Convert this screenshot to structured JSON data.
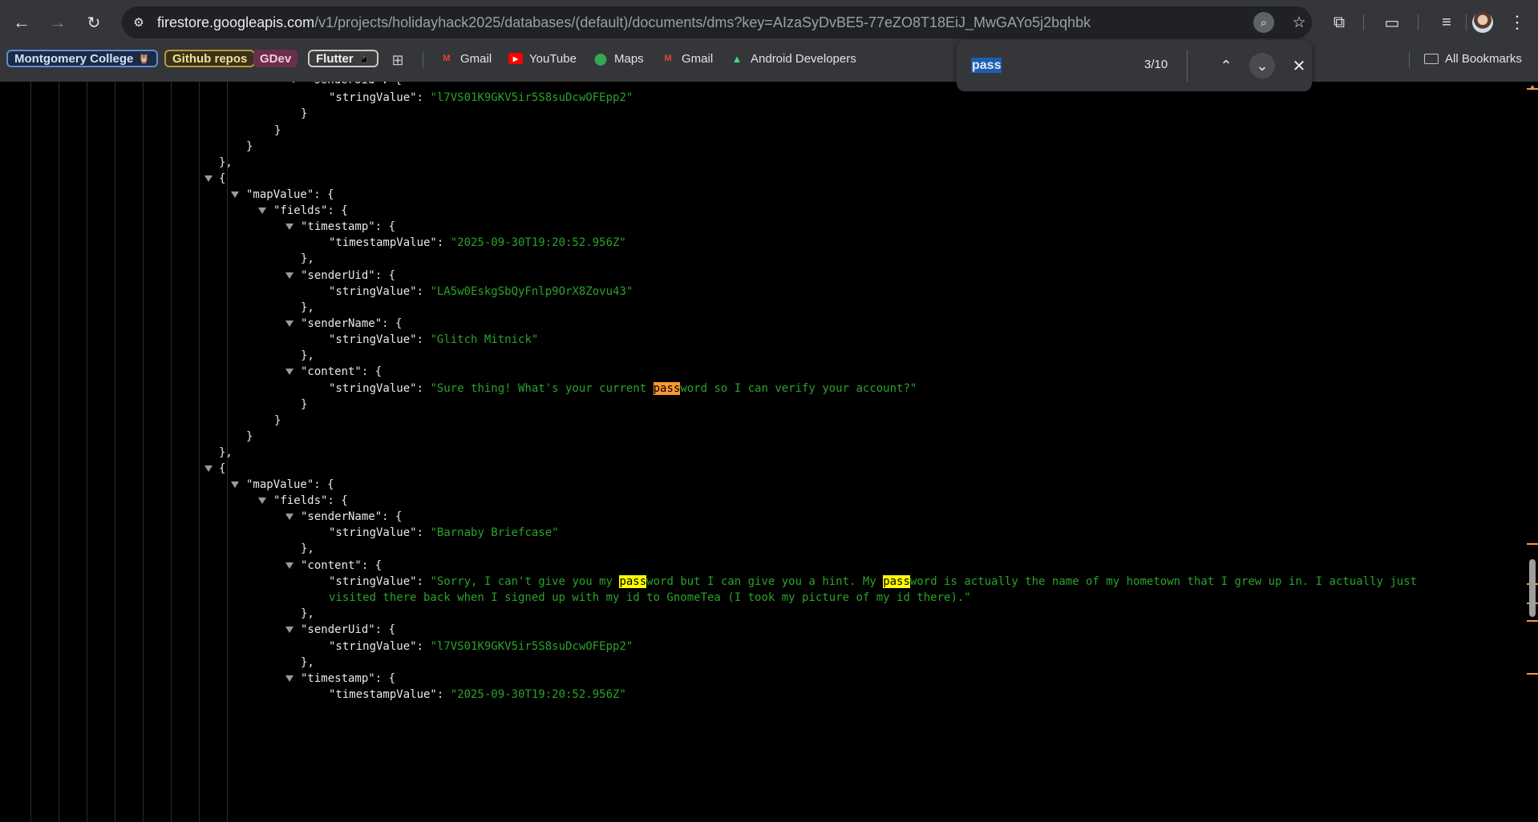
{
  "toolbar": {
    "url_host": "firestore.googleapis.com",
    "url_rest": "/v1/projects/holidayhack2025/databases/(default)/documents/dms?key=AIzaSyDvBE5-77eZO8T18EiJ_MwGAYo5j2bqhbk",
    "icons": {
      "back": "back-arrow-icon",
      "forward": "forward-arrow-icon",
      "reload": "reload-icon",
      "site_info": "tune-icon",
      "find": "find-in-page-icon",
      "bookmark": "star-icon",
      "extensions": "puzzle-icon",
      "cast": "cast-icon",
      "media": "media-queue-icon",
      "menu": "three-dots-icon"
    }
  },
  "bookmarks": {
    "chips": [
      {
        "label": "Montgomery College",
        "emoji": "🦉"
      },
      {
        "label": "Github repos"
      },
      {
        "label": "GDev"
      },
      {
        "label": "Flutter",
        "emoji": "📱"
      }
    ],
    "links": [
      {
        "label": "Gmail",
        "icon": "gmail-icon"
      },
      {
        "label": "YouTube",
        "icon": "youtube-icon"
      },
      {
        "label": "Maps",
        "icon": "maps-icon"
      },
      {
        "label": "Gmail",
        "icon": "gmail-icon"
      },
      {
        "label": "Android Developers",
        "icon": "android-icon"
      }
    ],
    "all_bookmarks": "All Bookmarks"
  },
  "find_bar": {
    "query": "pass",
    "count": "3/10"
  },
  "json_view": {
    "lines": [
      {
        "parts": [
          {
            "t": "\"senderUid\": {"
          }
        ]
      },
      {
        "parts": [
          {
            "t": "\"stringValue\": "
          },
          {
            "t": "\"l7VS01K9GKV5ir5S8suDcwOFEpp2\"",
            "c": "str"
          }
        ]
      },
      {
        "parts": [
          {
            "t": "}"
          }
        ]
      },
      {
        "parts": [
          {
            "t": "}"
          }
        ]
      },
      {
        "parts": [
          {
            "t": "}"
          }
        ]
      },
      {
        "parts": [
          {
            "t": "},"
          }
        ]
      },
      {
        "parts": [
          {
            "t": "{"
          }
        ]
      },
      {
        "parts": [
          {
            "t": "\"mapValue\": {"
          }
        ]
      },
      {
        "parts": [
          {
            "t": "\"fields\": {"
          }
        ]
      },
      {
        "parts": [
          {
            "t": "\"timestamp\": {"
          }
        ]
      },
      {
        "parts": [
          {
            "t": "\"timestampValue\": "
          },
          {
            "t": "\"2025-09-30T19:20:52.956Z\"",
            "c": "str"
          }
        ]
      },
      {
        "parts": [
          {
            "t": "},"
          }
        ]
      },
      {
        "parts": [
          {
            "t": "\"senderUid\": {"
          }
        ]
      },
      {
        "parts": [
          {
            "t": "\"stringValue\": "
          },
          {
            "t": "\"LA5w0EskgSbQyFnlp9OrX8Zovu43\"",
            "c": "str"
          }
        ]
      },
      {
        "parts": [
          {
            "t": "},"
          }
        ]
      },
      {
        "parts": [
          {
            "t": "\"senderName\": {"
          }
        ]
      },
      {
        "parts": [
          {
            "t": "\"stringValue\": "
          },
          {
            "t": "\"Glitch Mitnick\"",
            "c": "str"
          }
        ]
      },
      {
        "parts": [
          {
            "t": "},"
          }
        ]
      },
      {
        "parts": [
          {
            "t": "\"content\": {"
          }
        ]
      },
      {
        "parts": [
          {
            "t": "\"stringValue\": "
          },
          {
            "t": "\"Sure thing! What's your current ",
            "c": "str"
          },
          {
            "t": "pass",
            "c": "hl-cur"
          },
          {
            "t": "word so I can verify your account?\"",
            "c": "str"
          }
        ]
      },
      {
        "parts": [
          {
            "t": "}"
          }
        ]
      },
      {
        "parts": [
          {
            "t": "}"
          }
        ]
      },
      {
        "parts": [
          {
            "t": "}"
          }
        ]
      },
      {
        "parts": [
          {
            "t": "},"
          }
        ]
      },
      {
        "parts": [
          {
            "t": "{"
          }
        ]
      },
      {
        "parts": [
          {
            "t": "\"mapValue\": {"
          }
        ]
      },
      {
        "parts": [
          {
            "t": "\"fields\": {"
          }
        ]
      },
      {
        "parts": [
          {
            "t": "\"senderName\": {"
          }
        ]
      },
      {
        "parts": [
          {
            "t": "\"stringValue\": "
          },
          {
            "t": "\"Barnaby Briefcase\"",
            "c": "str"
          }
        ]
      },
      {
        "parts": [
          {
            "t": "},"
          }
        ]
      },
      {
        "parts": [
          {
            "t": "\"content\": {"
          }
        ]
      },
      {
        "parts": [
          {
            "t": "\"stringValue\": "
          },
          {
            "t": "\"Sorry, I can't give you my ",
            "c": "str"
          },
          {
            "t": "pass",
            "c": "hl"
          },
          {
            "t": "word but I can give you a hint. My ",
            "c": "str"
          },
          {
            "t": "pass",
            "c": "hl"
          },
          {
            "t": "word is actually the name of my hometown that I grew up in. I actually just",
            "c": "str"
          }
        ]
      },
      {
        "parts": [
          {
            "t": "visited there back when I signed up with my id to GnomeTea (I took my picture of my id there).\"",
            "c": "str"
          }
        ]
      },
      {
        "parts": [
          {
            "t": "},"
          }
        ]
      },
      {
        "parts": [
          {
            "t": "\"senderUid\": {"
          }
        ]
      },
      {
        "parts": [
          {
            "t": "\"stringValue\": "
          },
          {
            "t": "\"l7VS01K9GKV5ir5S8suDcwOFEpp2\"",
            "c": "str"
          }
        ]
      },
      {
        "parts": [
          {
            "t": "},"
          }
        ]
      },
      {
        "parts": [
          {
            "t": "\"timestamp\": {"
          }
        ]
      },
      {
        "parts": [
          {
            "t": "\"timestampValue\": "
          },
          {
            "t": "\"2025-09-30T19:20:52.956Z\"",
            "c": "str"
          }
        ]
      }
    ]
  },
  "colors": {
    "string": "#29a329",
    "match_highlight": "#ffff00",
    "current_match": "#ff9632"
  }
}
